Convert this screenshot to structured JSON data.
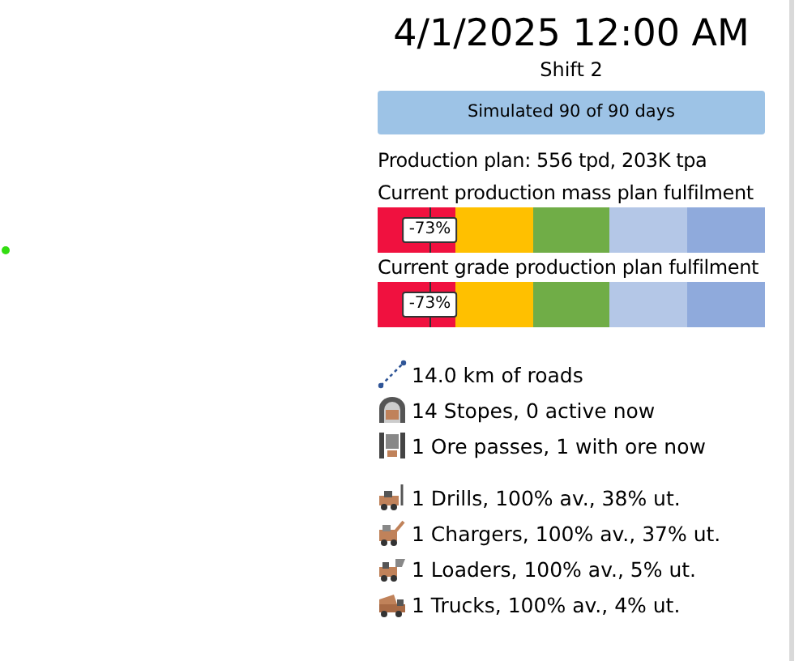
{
  "map": {
    "markers": [
      {
        "color": "#33dd11"
      }
    ]
  },
  "panel": {
    "datetime": "4/1/2025 12:00 AM",
    "shift": "Shift 2",
    "progress": {
      "label": "Simulated 90 of 90 days"
    },
    "plan": "Production plan: 556 tpd, 203K tpa",
    "gauges": [
      {
        "title": "Current production mass plan fulfilment",
        "reading": "-73%"
      },
      {
        "title": "Current grade production plan fulfilment",
        "reading": "-73%"
      }
    ],
    "infrastructure": [
      {
        "kind": "roads",
        "text": "14.0 km of roads"
      },
      {
        "kind": "stopes",
        "text": "14 Stopes, 0 active now"
      },
      {
        "kind": "orepass",
        "text": "1 Ore passes, 1 with ore now"
      }
    ],
    "equipment": [
      {
        "kind": "drill",
        "text": "1 Drills, 100% av., 38% ut."
      },
      {
        "kind": "charger",
        "text": "1 Chargers, 100% av., 37% ut."
      },
      {
        "kind": "loader",
        "text": "1 Loaders, 100% av., 5% ut."
      },
      {
        "kind": "truck",
        "text": "1 Trucks, 100% av., 4% ut."
      }
    ]
  }
}
